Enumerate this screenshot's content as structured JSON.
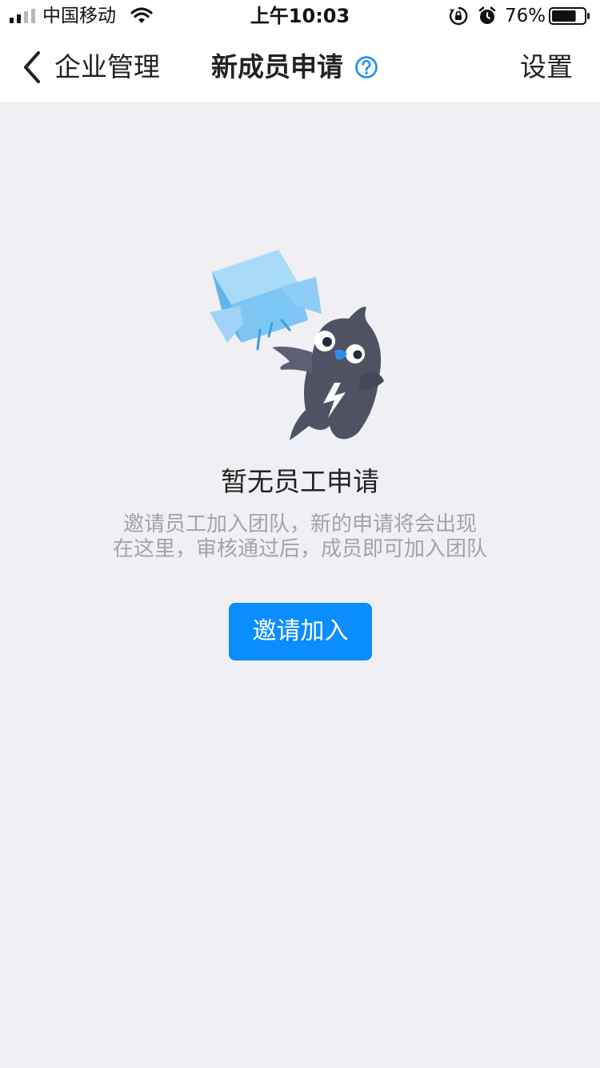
{
  "status_bar": {
    "carrier": "中国移动",
    "time": "上午10:03",
    "battery_percent": "76%",
    "battery_level": 0.76,
    "icons": [
      "signal-icon",
      "wifi-icon",
      "orientation-lock-icon",
      "alarm-icon",
      "battery-icon"
    ]
  },
  "navbar": {
    "back_label": "企业管理",
    "title": "新成员申请",
    "settings_label": "设置",
    "help_icon": "help-circle-icon",
    "accent_color": "#1a8cff"
  },
  "empty_state": {
    "title": "暂无员工申请",
    "description_line1": "邀请员工加入团队，新的申请将会出现",
    "description_line2": "在这里，审核通过后，成员即可加入团队",
    "illustration": "bird-mascot-throwing-box-illustration"
  },
  "actions": {
    "invite_label": "邀请加入",
    "invite_color": "#0a8dff"
  }
}
